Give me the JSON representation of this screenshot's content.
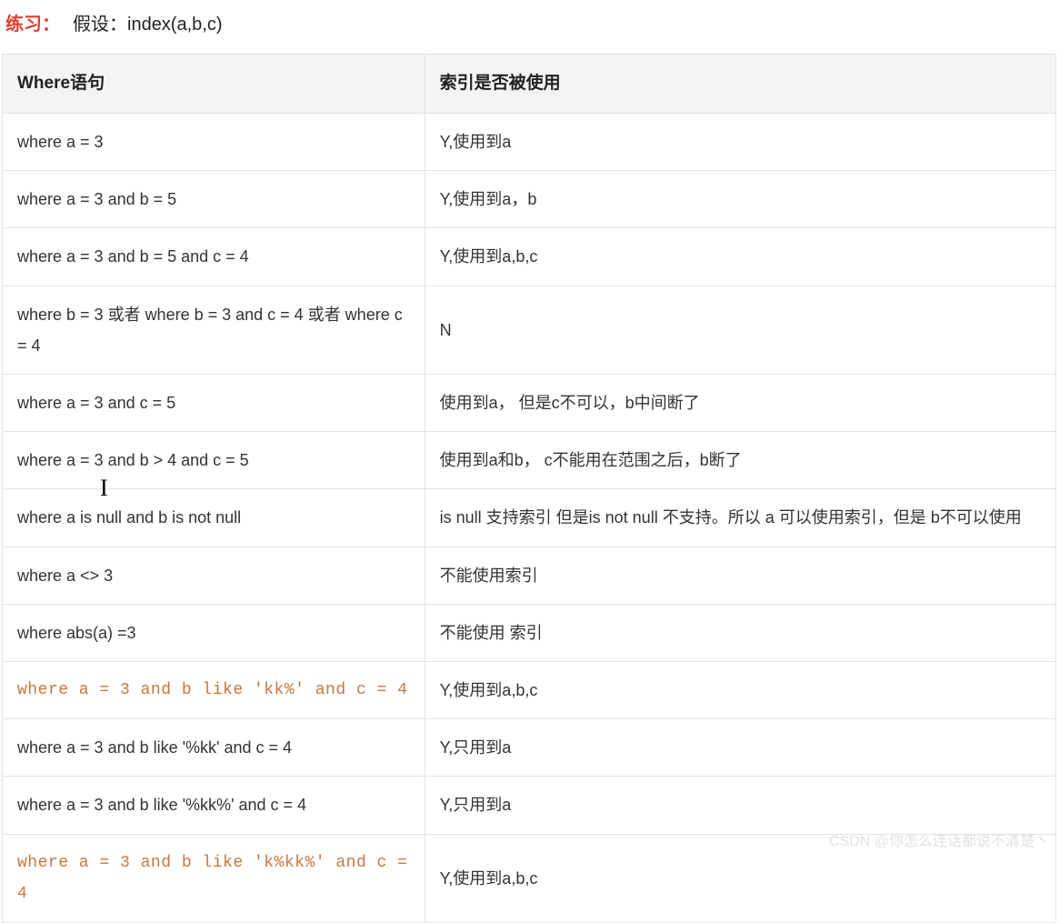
{
  "header": {
    "prefix": "练习：",
    "body": "假设：index(a,b,c)"
  },
  "table": {
    "headers": [
      "Where语句",
      "索引是否被使用"
    ],
    "rows": [
      {
        "where": "where a = 3",
        "used": "Y,使用到a",
        "code": false
      },
      {
        "where": "where a = 3 and b = 5",
        "used": "Y,使用到a，b",
        "code": false
      },
      {
        "where": "where a = 3 and b = 5 and c = 4",
        "used": "Y,使用到a,b,c",
        "code": false
      },
      {
        "where": "where b = 3 或者 where b = 3 and c = 4 或者 where c = 4",
        "used": "N",
        "code": false
      },
      {
        "where": "where a = 3 and c = 5",
        "used": "使用到a， 但是c不可以，b中间断了",
        "code": false
      },
      {
        "where": "where a = 3 and b > 4 and c = 5",
        "used": "使用到a和b， c不能用在范围之后，b断了",
        "code": false
      },
      {
        "where": "where a is  null and b is not null",
        "used": "is null 支持索引  但是is not null 不支持。所以 a 可以使用索引，但是 b不可以使用",
        "code": false
      },
      {
        "where": "where a  <> 3",
        "used": "不能使用索引",
        "code": false
      },
      {
        "where": "where  abs(a) =3",
        "used": "不能使用 索引",
        "code": false
      },
      {
        "where": "where a =  3 and b like 'kk%' and c = 4",
        "used": "Y,使用到a,b,c",
        "code": true
      },
      {
        "where": "where a = 3 and b like '%kk' and c = 4",
        "used": "Y,只用到a",
        "code": false
      },
      {
        "where": "where a = 3 and b like '%kk%' and c = 4",
        "used": "Y,只用到a",
        "code": false
      },
      {
        "where": "where a =  3 and b like 'k%kk%' and c =  4",
        "used": "Y,使用到a,b,c",
        "code": true
      }
    ]
  },
  "watermark": "CSDN @你怎么连话都说不清楚丶"
}
